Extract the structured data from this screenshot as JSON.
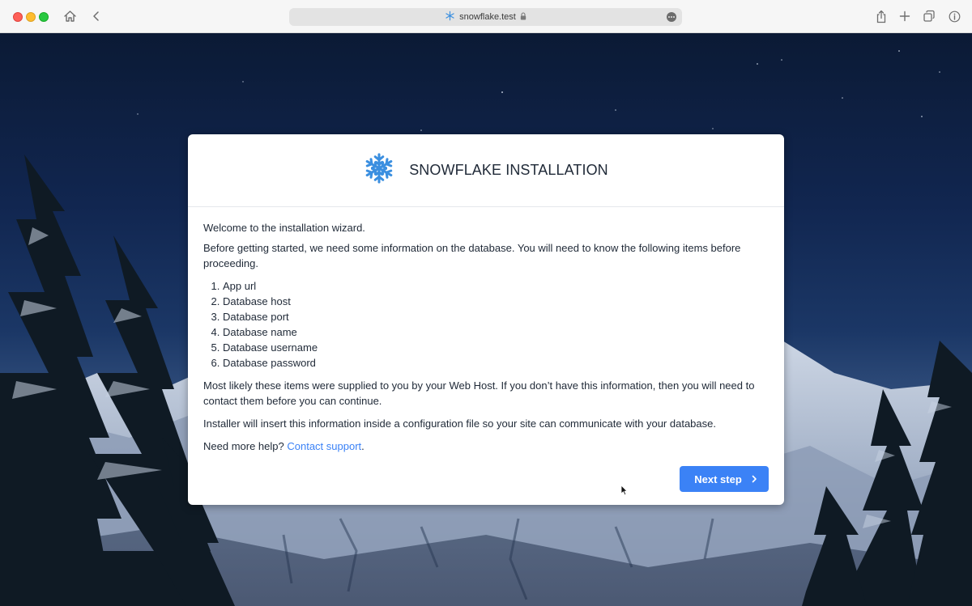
{
  "browser": {
    "url": "snowflake.test",
    "icons": {
      "home": "home-icon",
      "back": "chevron-left-icon",
      "share": "share-icon",
      "new_tab": "plus-icon",
      "tabs": "tabs-overview-icon",
      "info": "info-icon",
      "lock": "lock-icon",
      "more": "more-icon",
      "site": "snowflake-icon"
    }
  },
  "installer": {
    "title": "SNOWFLAKE INSTALLATION",
    "welcome": "Welcome to the installation wizard.",
    "intro": "Before getting started, we need some information on the database. You will need to know the following items before proceeding.",
    "items": [
      "App url",
      "Database host",
      "Database port",
      "Database name",
      "Database username",
      "Database password"
    ],
    "supplied": "Most likely these items were supplied to you by your Web Host. If you don’t have this information, then you will need to contact them before you can continue.",
    "config": "Installer will insert this information inside a configuration file so your site can communicate with your database.",
    "help_prefix": "Need more help?",
    "help_link": "Contact support",
    "help_suffix": ".",
    "next_button": "Next step"
  },
  "colors": {
    "accent": "#3b82f6",
    "logo": "#3b8fe0",
    "text": "#1f2937"
  }
}
